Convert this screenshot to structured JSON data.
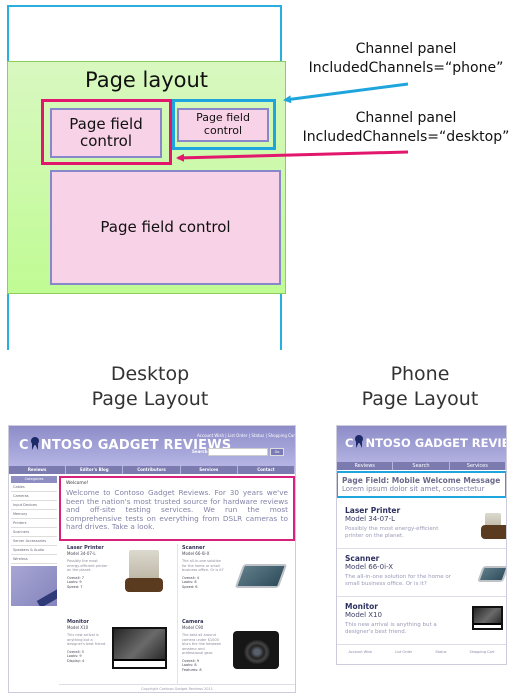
{
  "diagram": {
    "page_layout_title": "Page layout",
    "page_field_controls": [
      "Page field control",
      "Page field control",
      "Page field control"
    ],
    "callouts": {
      "phone": {
        "line1": "Channel panel",
        "line2": "IncludedChannels=“phone”",
        "color": "#1ea5dd"
      },
      "desktop": {
        "line1": "Channel panel",
        "line2": "IncludedChannels=“desktop”",
        "color": "#e2166d"
      }
    },
    "colors": {
      "frame": "#29aee0",
      "page_layout_fill": "#c0fb94",
      "control_fill": "#f8d2e6"
    }
  },
  "sections": {
    "desktop": {
      "line1": "Desktop",
      "line2": "Page Layout"
    },
    "phone": {
      "line1": "Phone",
      "line2": "Page Layout"
    }
  },
  "desktop": {
    "logo_pre": "C",
    "logo_post": "NTOSO GADGET REVIEWS",
    "top_links": "Account Wish  |  List Order  |  Status  |  Shopping Cart",
    "search_label": "Search:",
    "search_value": "",
    "go_label": "Go",
    "nav": [
      "Reviews",
      "Editor's Blog",
      "Contributors",
      "Services",
      "Contact"
    ],
    "categories_title": "Categories",
    "categories": [
      "Cables",
      "Cameras",
      "Input Devices",
      "Memory",
      "Printers",
      "Scanners",
      "Server Accessories",
      "Speakers & Audio",
      "Wireless"
    ],
    "welcome_heading": "Welcome!",
    "welcome_text": "Welcome to Contoso Gadget Reviews.  For 30 years we've been the nation's most trusted source for hardware reviews and off-site testing services.  We run the most comprehensive tests on everything from DSLR cameras to hard drives.  Take a look.",
    "products": [
      {
        "title": "Laser Printer",
        "model": "Model 34-07-L",
        "desc": "Possibly the most energy-efficient printer on the planet.",
        "stats": [
          "Overall: 7",
          "Looks: 9",
          "Speed: 7"
        ]
      },
      {
        "title": "Scanner",
        "model": "Model 66-0i-X",
        "desc": "The all-in-one solution for the home or small business office. Or is it?",
        "stats": [
          "Overall: 4",
          "Looks: 8",
          "Speed: 6"
        ]
      },
      {
        "title": "Monitor",
        "model": "Model X10",
        "desc": "This new arrival is anything but a designer's best friend.",
        "stats": [
          "Overall: 5",
          "Looks: 9",
          "Display: 4"
        ]
      },
      {
        "title": "Camera",
        "model": "Model C90",
        "desc": "The best all around camera under $1000 blurs the line between amateur and professional gear.",
        "stats": [
          "Overall: 9",
          "Looks: 8",
          "Features: 8"
        ]
      }
    ],
    "footer": "Copyright Contoso Gadget Reviews 2011"
  },
  "phone": {
    "logo_pre": "C",
    "logo_post": "NTOSO GADGET REVIEWS",
    "nav": [
      "Reviews",
      "Search",
      "Services"
    ],
    "welcome_heading": "Page Field: Mobile Welcome Message",
    "welcome_text": "Lorem ipsum dolor sit amet, consectetur",
    "products": [
      {
        "title": "Laser Printer",
        "model": "Model 34-07-L",
        "desc": "Possibly the most energy-efficient printer on the planet."
      },
      {
        "title": "Scanner",
        "model": "Model 66-0i-X",
        "desc": "The all-in-one solution for the home or small business office.  Or is it?"
      },
      {
        "title": "Monitor",
        "model": "Model X10",
        "desc": "This new arrival is anything but a designer's best friend."
      }
    ],
    "footer_links": [
      "Account Wish",
      "List Order",
      "Status",
      "Shopping Cart"
    ]
  }
}
